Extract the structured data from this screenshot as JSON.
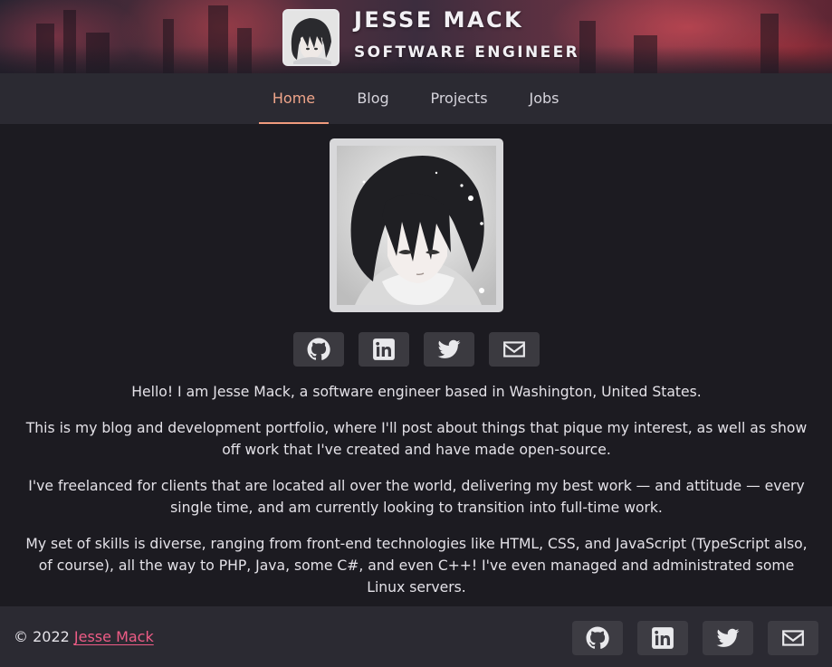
{
  "header": {
    "name": "JESSE MACK",
    "role": "SOFTWARE ENGINEER",
    "avatar_icon": "anime-character-avatar"
  },
  "nav": {
    "items": [
      {
        "label": "Home",
        "active": true
      },
      {
        "label": "Blog",
        "active": false
      },
      {
        "label": "Projects",
        "active": false
      },
      {
        "label": "Jobs",
        "active": false
      }
    ]
  },
  "profile": {
    "photo_icon": "anime-character-portrait",
    "social": [
      "github-icon",
      "linkedin-icon",
      "twitter-icon",
      "email-icon"
    ]
  },
  "content": {
    "paragraphs": [
      "Hello! I am Jesse Mack, a software engineer based in Washington, United States.",
      "This is my blog and development portfolio, where I'll post about things that pique my interest, as well as show off work that I've created and have made open-source.",
      "I've freelanced for clients that are located all over the world, delivering my best work — and attitude — every single time, and am currently looking to transition into full-time work.",
      "My set of skills is diverse, ranging from front-end technologies like HTML, CSS, and JavaScript (TypeScript also, of course), all the way to PHP, Java, some C#, and even C++! I've even managed and administrated some Linux servers."
    ]
  },
  "footer": {
    "copyright_prefix": "© 2022",
    "copyright_name": "Jesse Mack",
    "social": [
      "github-icon",
      "linkedin-icon",
      "twitter-icon",
      "email-icon"
    ]
  },
  "colors": {
    "background": "#1c1b21",
    "nav_background": "#2b2a32",
    "accent_active": "#ef9a7d",
    "link": "#ee5c86",
    "button": "#3b3a40"
  }
}
